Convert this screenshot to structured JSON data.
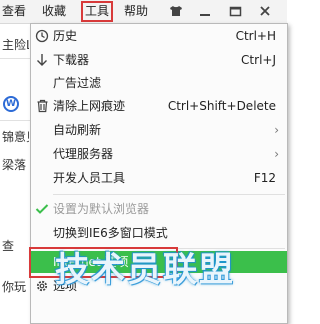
{
  "menubar": {
    "view": "查看",
    "favorites": "收藏",
    "tools": "工具",
    "help": "帮助"
  },
  "background": {
    "line1": "主险L",
    "line2": "锦意见",
    "line3": "梁落",
    "line4": "查",
    "line5": "你玩"
  },
  "tools_menu": {
    "items": [
      {
        "label": "历史",
        "shortcut": "Ctrl+H",
        "icon": "clock-icon"
      },
      {
        "label": "下载器",
        "shortcut": "Ctrl+J",
        "icon": "download-arrow-icon"
      },
      {
        "label": "广告过滤",
        "shortcut": ""
      },
      {
        "label": "清除上网痕迹",
        "shortcut": "Ctrl+Shift+Delete",
        "icon": "trash-icon"
      },
      {
        "label": "自动刷新",
        "submenu": "›"
      },
      {
        "label": "代理服务器",
        "submenu": "›"
      },
      {
        "label": "开发人员工具",
        "shortcut": "F12"
      },
      {
        "label": "设置为默认浏览器",
        "disabled": true,
        "icon": "checkmark-icon"
      },
      {
        "label": "切换到IE6多窗口模式"
      },
      {
        "label": "Internet 选项",
        "highlighted": true
      },
      {
        "label": "选项",
        "icon": "gear-icon"
      }
    ]
  },
  "watermark": "技术员联盟",
  "colors": {
    "highlight": "#3bbf4b",
    "annotation_red": "#d83a3a",
    "accent_blue": "#2d6bd6"
  }
}
